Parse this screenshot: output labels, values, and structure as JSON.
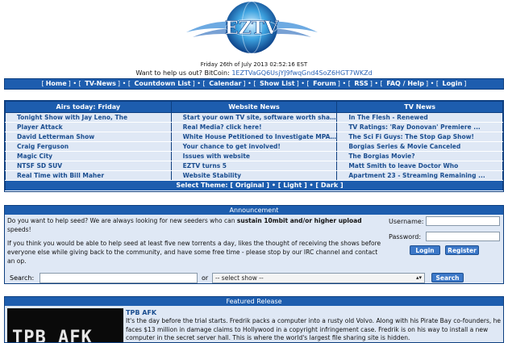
{
  "header": {
    "date": "Friday 26th of July 2013 02:52:16 EST",
    "bitcoin_prefix": "Want to help us out? BitCoin:",
    "bitcoin_address": "1EZTVaGQ6UsjYJ9fwqGnd4SoZ6HGT7WKZd",
    "logo_letters": "EZTV"
  },
  "nav": [
    {
      "label": "Home"
    },
    {
      "label": "TV-News"
    },
    {
      "label": "Countdown List"
    },
    {
      "label": "Calendar"
    },
    {
      "label": "Show List"
    },
    {
      "label": "Forum"
    },
    {
      "label": "RSS"
    },
    {
      "label": "FAQ / Help"
    },
    {
      "label": "Login"
    }
  ],
  "tvtable": {
    "col1_header": "Airs today: Friday",
    "col2_header": "Website News",
    "col3_header": "TV News",
    "rows": [
      [
        "Tonight Show with Jay Leno, The",
        "Start your own TV site, software worth shari...",
        "In The Flesh - Renewed"
      ],
      [
        "Player Attack",
        "Real Media? click here!",
        "TV Ratings: 'Ray Donovan' Premiere ..."
      ],
      [
        "David Letterman Show",
        "White House Petitioned to Investigate MPAA Br...",
        "The Sci Fi Guys: The Stop Gap Show!"
      ],
      [
        "Craig Ferguson",
        "Your chance to get involved!",
        "Borgias Series & Movie Canceled"
      ],
      [
        "Magic City",
        "Issues with website",
        "The Borgias Movie?"
      ],
      [
        "NTSF SD SUV",
        "EZTV turns 5",
        "Matt Smith to leave Doctor Who"
      ],
      [
        "Real Time with Bill Maher",
        "Website Stability",
        "Apartment 23 - Streaming Remaining ..."
      ]
    ],
    "theme_label": "Select Theme:",
    "themes": [
      "Original",
      "Light",
      "Dark"
    ]
  },
  "announcement": {
    "title": "Announcement",
    "line1_pre": "Do you want to help seed? We are always looking for new seeders who can ",
    "line1_bold": "sustain 10mbit and/or higher upload",
    "line2": "speeds!",
    "para2": "If you think you would be able to help seed at least five new torrents a day, likes the thought of receiving the shows before everyone else while giving back to the community, and have some free time - please stop by our IRC channel and contact an op.",
    "username_label": "Username:",
    "password_label": "Password:",
    "login_button": "Login",
    "register_button": "Register"
  },
  "search": {
    "label": "Search:",
    "or_label": "or",
    "select_value": "-- select show --",
    "button": "Search"
  },
  "featured": {
    "title": "Featured Release",
    "release_title": "TPB AFK",
    "text": "It's the day before the trial starts. Fredrik packs a computer into a rusty old Volvo. Along with his Pirate Bay co-founders, he faces $13 million in damage claims to Hollywood in a copyright infringement case. Fredrik is on his way to install a new computer in the secret server hall. This is where the world's largest file sharing site is hidden.",
    "image_text": "TPB AFK"
  }
}
